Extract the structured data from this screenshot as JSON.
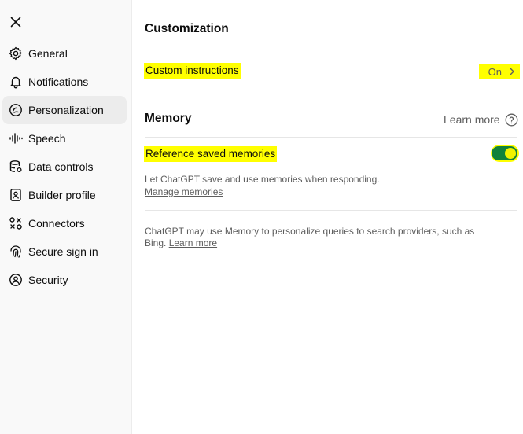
{
  "sidebar": {
    "items": [
      {
        "label": "General",
        "icon": "gear-icon"
      },
      {
        "label": "Notifications",
        "icon": "bell-icon"
      },
      {
        "label": "Personalization",
        "icon": "personalization-icon",
        "active": true
      },
      {
        "label": "Speech",
        "icon": "waveform-icon"
      },
      {
        "label": "Data controls",
        "icon": "database-icon"
      },
      {
        "label": "Builder profile",
        "icon": "id-card-icon"
      },
      {
        "label": "Connectors",
        "icon": "connectors-icon"
      },
      {
        "label": "Secure sign in",
        "icon": "fingerprint-icon"
      },
      {
        "label": "Security",
        "icon": "shield-user-icon"
      }
    ]
  },
  "customization": {
    "title": "Customization",
    "custom_instructions_label": "Custom instructions",
    "custom_instructions_value": "On"
  },
  "memory": {
    "title": "Memory",
    "learn_more": "Learn more",
    "reference_saved_label": "Reference saved memories",
    "reference_saved_enabled": true,
    "description": "Let ChatGPT save and use memories when responding.",
    "manage_link": "Manage memories",
    "footer_text_line1": "ChatGPT may use Memory to personalize queries to search providers, such as",
    "footer_text_line2": "Bing.",
    "footer_link": "Learn more"
  },
  "colors": {
    "highlight": "#ffff00",
    "toggle_on": "#12823a"
  }
}
